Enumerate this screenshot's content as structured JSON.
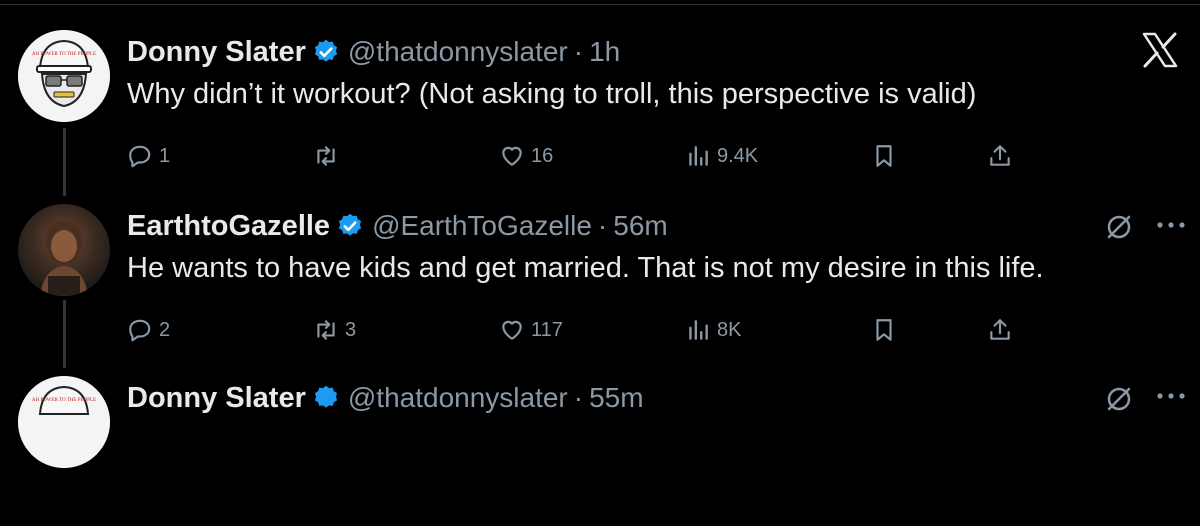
{
  "colors": {
    "background": "#000000",
    "text": "#e7e9ea",
    "muted": "#8b98a5",
    "verified": "#1d9bf0"
  },
  "close_icon": "x-logo-icon",
  "tweets": [
    {
      "name": "Donny Slater",
      "handle": "@thatdonnyslater",
      "separator": "·",
      "time": "1h",
      "text": "Why didn’t it workout? (Not asking to troll, this perspective is valid)",
      "avatar_text": "AH POWER TO THE PEOPLE",
      "replies": "1",
      "reposts": "",
      "likes": "16",
      "views": "9.4K"
    },
    {
      "name": "EarthtoGazelle",
      "handle": "@EarthToGazelle",
      "separator": "·",
      "time": "56m",
      "text": "He wants to have kids and get married. That is not my desire in  this life.",
      "replies": "2",
      "reposts": "3",
      "likes": "117",
      "views": "8K"
    },
    {
      "name": "Donny Slater",
      "handle": "@thatdonnyslater",
      "separator": "·",
      "time": "55m",
      "avatar_text": "AH POWER TO THE PEOPLE"
    }
  ]
}
